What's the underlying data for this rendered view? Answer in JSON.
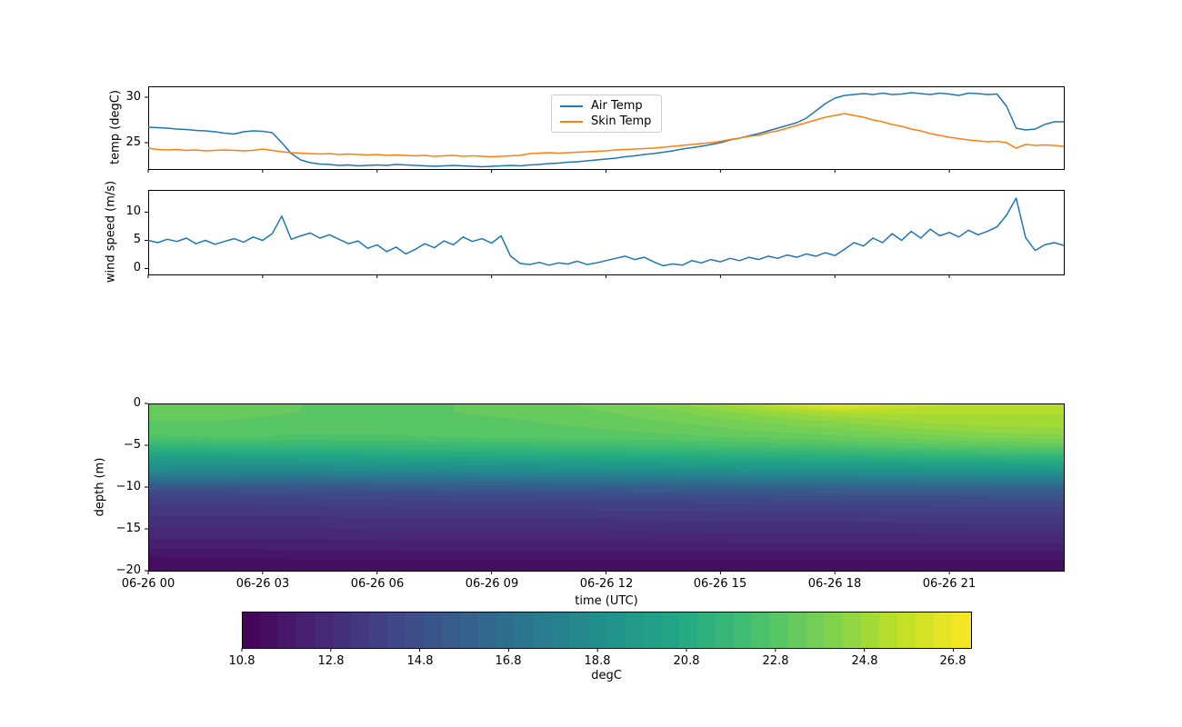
{
  "colors": {
    "air_line": "#1f77b4",
    "skin_line": "#ff7f0e",
    "axis": "#000000",
    "legend_border": "#cccccc",
    "viridis_stops": [
      "#440154",
      "#482475",
      "#414487",
      "#355f8d",
      "#2a788e",
      "#21918c",
      "#22a884",
      "#44bf70",
      "#7ad151",
      "#bddf26",
      "#fde725"
    ]
  },
  "chart_data": [
    {
      "type": "line",
      "name": "temperature-panel",
      "ylabel": "temp (degC)",
      "yticks": [
        25,
        30
      ],
      "ytick_labels": [
        "25",
        "30"
      ],
      "ylim": [
        22.1,
        31.2
      ],
      "xlim_hours": [
        0,
        24
      ],
      "xticks_hours": [
        0,
        3,
        6,
        9,
        12,
        15,
        18,
        21
      ],
      "legend_position": "upper center",
      "x_start": 0,
      "x_step": 0.25,
      "series": [
        {
          "name": "Air Temp",
          "color": "#1f77b4",
          "values": [
            26.7,
            26.65,
            26.6,
            26.5,
            26.45,
            26.35,
            26.3,
            26.2,
            26.05,
            25.95,
            26.2,
            26.3,
            26.25,
            26.1,
            25.0,
            23.8,
            23.1,
            22.8,
            22.65,
            22.6,
            22.5,
            22.55,
            22.45,
            22.5,
            22.55,
            22.5,
            22.6,
            22.55,
            22.5,
            22.45,
            22.4,
            22.45,
            22.5,
            22.45,
            22.4,
            22.35,
            22.4,
            22.45,
            22.5,
            22.45,
            22.55,
            22.6,
            22.7,
            22.75,
            22.85,
            22.9,
            23.0,
            23.1,
            23.2,
            23.3,
            23.45,
            23.55,
            23.7,
            23.8,
            23.95,
            24.1,
            24.3,
            24.45,
            24.6,
            24.8,
            25.0,
            25.3,
            25.5,
            25.75,
            26.0,
            26.3,
            26.6,
            26.9,
            27.2,
            27.7,
            28.5,
            29.3,
            29.9,
            30.2,
            30.3,
            30.4,
            30.3,
            30.45,
            30.3,
            30.35,
            30.5,
            30.4,
            30.3,
            30.45,
            30.35,
            30.2,
            30.45,
            30.4,
            30.3,
            30.35,
            29.0,
            26.6,
            26.4,
            26.5,
            27.0,
            27.3,
            27.3
          ]
        },
        {
          "name": "Skin Temp",
          "color": "#ff7f0e",
          "values": [
            24.4,
            24.25,
            24.2,
            24.25,
            24.15,
            24.2,
            24.1,
            24.15,
            24.2,
            24.15,
            24.1,
            24.15,
            24.3,
            24.15,
            24.0,
            23.9,
            23.85,
            23.8,
            23.75,
            23.8,
            23.7,
            23.75,
            23.7,
            23.65,
            23.7,
            23.6,
            23.65,
            23.6,
            23.55,
            23.6,
            23.5,
            23.55,
            23.6,
            23.5,
            23.55,
            23.5,
            23.45,
            23.5,
            23.55,
            23.6,
            23.8,
            23.85,
            23.9,
            23.85,
            23.9,
            23.95,
            24.0,
            24.05,
            24.1,
            24.2,
            24.25,
            24.3,
            24.35,
            24.4,
            24.5,
            24.6,
            24.7,
            24.8,
            24.9,
            25.0,
            25.15,
            25.35,
            25.5,
            25.7,
            25.8,
            26.1,
            26.3,
            26.6,
            26.9,
            27.2,
            27.5,
            27.8,
            28.0,
            28.2,
            28.0,
            27.8,
            27.5,
            27.3,
            27.0,
            26.8,
            26.5,
            26.3,
            26.0,
            25.8,
            25.6,
            25.45,
            25.3,
            25.2,
            25.1,
            25.15,
            25.0,
            24.4,
            24.8,
            24.7,
            24.75,
            24.7,
            24.6
          ]
        }
      ]
    },
    {
      "type": "line",
      "name": "wind-panel",
      "ylabel": "wind speed (m/s)",
      "yticks": [
        0,
        5,
        10
      ],
      "ytick_labels": [
        "0",
        "5",
        "10"
      ],
      "ylim": [
        -1.05,
        13.95
      ],
      "xlim_hours": [
        0,
        24
      ],
      "xticks_hours": [
        0,
        3,
        6,
        9,
        12,
        15,
        18,
        21
      ],
      "x_start": 0,
      "x_step": 0.25,
      "series": [
        {
          "name": "wind speed",
          "color": "#1f77b4",
          "values": [
            5.0,
            4.6,
            5.2,
            4.8,
            5.4,
            4.4,
            5.0,
            4.3,
            4.8,
            5.3,
            4.7,
            5.6,
            5.0,
            6.2,
            9.3,
            5.2,
            5.8,
            6.3,
            5.4,
            6.0,
            5.2,
            4.4,
            4.9,
            3.6,
            4.2,
            3.0,
            3.8,
            2.6,
            3.4,
            4.4,
            3.7,
            4.9,
            4.2,
            5.6,
            4.8,
            5.3,
            4.5,
            5.8,
            2.2,
            0.9,
            0.7,
            1.1,
            0.6,
            1.0,
            0.8,
            1.3,
            0.7,
            1.0,
            1.4,
            1.8,
            2.2,
            1.6,
            2.0,
            1.2,
            0.5,
            0.8,
            0.6,
            1.4,
            1.0,
            1.6,
            1.2,
            1.8,
            1.4,
            2.0,
            1.6,
            2.2,
            1.8,
            2.4,
            2.0,
            2.6,
            2.2,
            2.8,
            2.3,
            3.4,
            4.6,
            4.0,
            5.4,
            4.6,
            6.2,
            5.0,
            6.6,
            5.4,
            7.0,
            5.8,
            6.4,
            5.6,
            6.8,
            6.0,
            6.6,
            7.4,
            9.5,
            12.5,
            5.5,
            3.2,
            4.2,
            4.6,
            4.1
          ]
        }
      ]
    },
    {
      "type": "heatmap",
      "name": "water-temperature-panel",
      "ylabel": "depth (m)",
      "xlabel": "time (UTC)",
      "yticks": [
        0,
        -5,
        -10,
        -15,
        -20
      ],
      "ytick_labels": [
        "0",
        "−5",
        "−10",
        "−15",
        "−20"
      ],
      "ylim": [
        0,
        -20
      ],
      "xlim_hours": [
        0,
        24
      ],
      "xticks_hours": [
        0,
        3,
        6,
        9,
        12,
        15,
        18,
        21
      ],
      "xtick_labels": [
        "06-26 00",
        "06-26 03",
        "06-26 06",
        "06-26 09",
        "06-26 12",
        "06-26 15",
        "06-26 18",
        "06-26 21"
      ],
      "vmin": 10.8,
      "vmax": 27.2,
      "levels": 40,
      "times_hours": [
        0,
        2,
        4,
        6,
        8,
        10,
        12,
        14,
        16,
        18,
        20,
        22,
        24
      ],
      "depths_m": [
        0,
        -1,
        -2,
        -3,
        -4,
        -5,
        -6,
        -7,
        -8,
        -9,
        -10,
        -11,
        -12,
        -13,
        -14,
        -15,
        -16,
        -17,
        -18,
        -19,
        -20
      ],
      "values_degC": [
        [
          23.2,
          23.2,
          23.1,
          23.0,
          22.6,
          21.6,
          20.5,
          19.5,
          18.5,
          17.0,
          15.2,
          14.2,
          13.7,
          13.4,
          13.1,
          12.8,
          12.5,
          12.2,
          11.8,
          11.4,
          11.3
        ],
        [
          23.2,
          23.2,
          23.1,
          23.0,
          22.7,
          21.7,
          20.6,
          19.5,
          18.4,
          16.9,
          15.2,
          14.2,
          13.7,
          13.4,
          13.1,
          12.8,
          12.5,
          12.2,
          11.8,
          11.5,
          11.3
        ],
        [
          23.1,
          23.1,
          23.0,
          22.9,
          22.6,
          21.7,
          20.6,
          19.6,
          18.4,
          16.8,
          15.3,
          14.3,
          13.8,
          13.4,
          13.1,
          12.8,
          12.5,
          12.2,
          11.9,
          11.5,
          11.3
        ],
        [
          23.0,
          23.0,
          23.0,
          22.9,
          22.6,
          21.8,
          20.8,
          19.7,
          18.5,
          16.9,
          15.4,
          14.4,
          13.8,
          13.5,
          13.2,
          12.9,
          12.6,
          12.2,
          11.9,
          11.5,
          11.3
        ],
        [
          23.1,
          23.1,
          23.0,
          22.9,
          22.7,
          21.9,
          20.9,
          19.8,
          18.6,
          17.1,
          15.5,
          14.5,
          13.9,
          13.5,
          13.2,
          12.9,
          12.6,
          12.3,
          11.9,
          11.5,
          11.3
        ],
        [
          23.3,
          23.2,
          23.1,
          23.0,
          22.8,
          22.0,
          21.0,
          19.9,
          18.7,
          17.2,
          15.6,
          14.5,
          13.9,
          13.5,
          13.2,
          12.9,
          12.6,
          12.3,
          11.9,
          11.5,
          11.3
        ],
        [
          23.7,
          23.5,
          23.3,
          23.1,
          22.9,
          22.1,
          21.1,
          20.0,
          18.8,
          17.3,
          15.7,
          14.6,
          14.0,
          13.6,
          13.2,
          12.9,
          12.6,
          12.3,
          11.9,
          11.5,
          11.3
        ],
        [
          24.3,
          23.9,
          23.6,
          23.3,
          23.0,
          22.2,
          21.2,
          20.1,
          18.9,
          17.4,
          15.8,
          14.7,
          14.0,
          13.6,
          13.3,
          13.0,
          12.6,
          12.3,
          11.9,
          11.5,
          11.3
        ],
        [
          25.4,
          24.5,
          24.0,
          23.6,
          23.2,
          22.4,
          21.3,
          20.2,
          19.0,
          17.5,
          15.9,
          14.8,
          14.1,
          13.7,
          13.3,
          13.0,
          12.7,
          12.3,
          11.9,
          11.5,
          11.3
        ],
        [
          26.9,
          25.2,
          24.4,
          23.9,
          23.4,
          22.6,
          21.5,
          20.3,
          19.1,
          17.6,
          16.0,
          14.9,
          14.2,
          13.7,
          13.3,
          13.0,
          12.7,
          12.3,
          11.9,
          11.5,
          11.3
        ],
        [
          25.8,
          25.3,
          24.8,
          24.3,
          23.7,
          22.9,
          21.7,
          20.5,
          19.2,
          17.7,
          16.1,
          15.0,
          14.2,
          13.8,
          13.4,
          13.0,
          12.7,
          12.3,
          11.9,
          11.5,
          11.3
        ],
        [
          25.4,
          25.2,
          25.0,
          24.6,
          24.0,
          23.1,
          21.9,
          20.6,
          19.3,
          17.8,
          16.2,
          15.0,
          14.3,
          13.8,
          13.4,
          13.1,
          12.7,
          12.3,
          11.9,
          11.5,
          11.3
        ],
        [
          25.3,
          25.2,
          25.0,
          24.7,
          24.1,
          23.2,
          22.0,
          20.7,
          19.4,
          17.9,
          16.2,
          15.1,
          14.3,
          13.8,
          13.4,
          13.1,
          12.7,
          12.3,
          11.9,
          11.5,
          11.3
        ]
      ]
    }
  ],
  "colorbar": {
    "label": "degC",
    "ticks": [
      10.8,
      12.8,
      14.8,
      16.8,
      18.8,
      20.8,
      22.8,
      24.8,
      26.8
    ],
    "tick_labels": [
      "10.8",
      "12.8",
      "14.8",
      "16.8",
      "18.8",
      "20.8",
      "22.8",
      "24.8",
      "26.8"
    ],
    "vmin": 10.8,
    "vmax": 27.2,
    "segments": 40
  }
}
